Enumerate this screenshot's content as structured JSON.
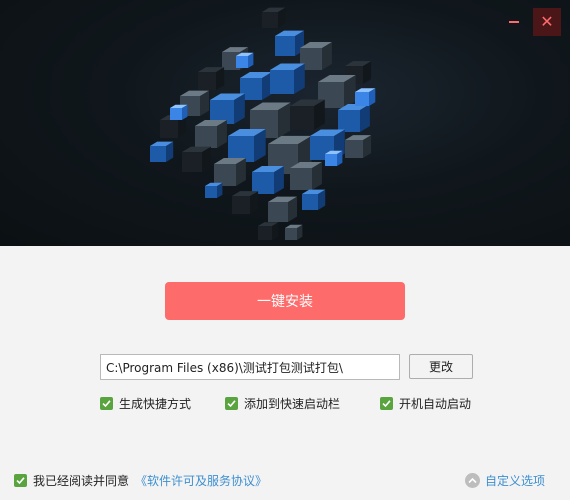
{
  "window": {
    "minimize_icon": "minimize-icon",
    "close_icon": "close-icon",
    "close_bg": "#4b1618",
    "accent": "#ff6a6a"
  },
  "install": {
    "label": "一键安装",
    "color": "#fe6b6b"
  },
  "path": {
    "value": "C:\\Program Files (x86)\\测试打包测试打包\\",
    "change_label": "更改"
  },
  "options": [
    {
      "label": "生成快捷方式",
      "checked": true
    },
    {
      "label": "添加到快速启动栏",
      "checked": true
    },
    {
      "label": "开机自动启动",
      "checked": true
    }
  ],
  "agreement": {
    "checked": true,
    "text": "我已经阅读并同意",
    "link": "《软件许可及服务协议》"
  },
  "custom_options": {
    "label": "自定义选项",
    "icon": "chevron-up-icon"
  },
  "checkbox_color": "#5aa43f",
  "link_color": "#3d8fd0"
}
